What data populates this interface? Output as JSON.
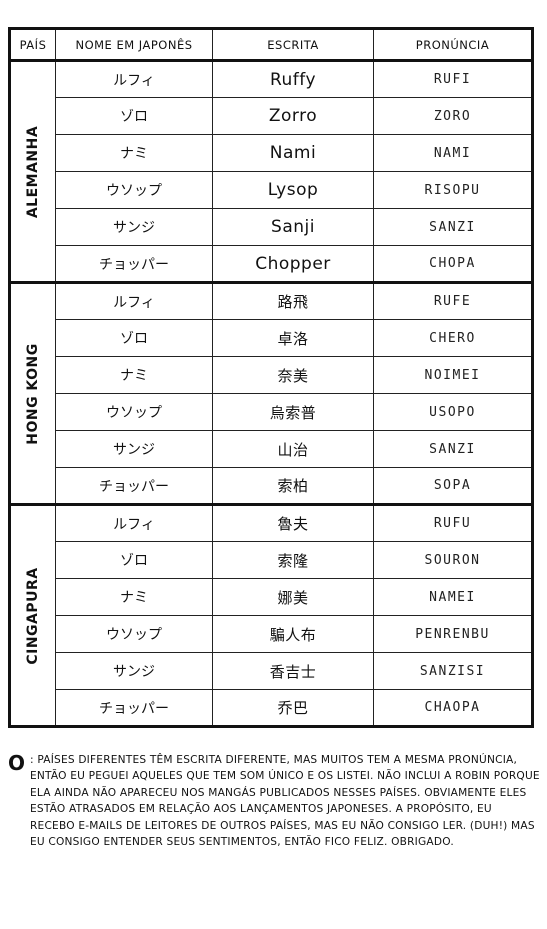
{
  "table": {
    "headers": [
      "PAÍS",
      "NOME EM JAPONÊS",
      "ESCRITA",
      "PRONÚNCIA"
    ],
    "groups": [
      {
        "country": "ALEMANHA",
        "rows": [
          {
            "jp": "ルフィ",
            "written": "Ruffy",
            "pron": "RUFI"
          },
          {
            "jp": "ゾロ",
            "written": "Zorro",
            "pron": "ZORO"
          },
          {
            "jp": "ナミ",
            "written": "Nami",
            "pron": "NAMI"
          },
          {
            "jp": "ウソップ",
            "written": "Lysop",
            "pron": "RISOPU"
          },
          {
            "jp": "サンジ",
            "written": "Sanji",
            "pron": "SANZI"
          },
          {
            "jp": "チョッパー",
            "written": "Chopper",
            "pron": "CHOPA"
          }
        ]
      },
      {
        "country": "HONG KONG",
        "rows": [
          {
            "jp": "ルフィ",
            "written": "路飛",
            "pron": "RUFE"
          },
          {
            "jp": "ゾロ",
            "written": "卓洛",
            "pron": "CHERO"
          },
          {
            "jp": "ナミ",
            "written": "奈美",
            "pron": "NOIMEI"
          },
          {
            "jp": "ウソップ",
            "written": "烏索普",
            "pron": "USOPO"
          },
          {
            "jp": "サンジ",
            "written": "山治",
            "pron": "SANZI"
          },
          {
            "jp": "チョッパー",
            "written": "索柏",
            "pron": "SOPA"
          }
        ]
      },
      {
        "country": "CINGAPURA",
        "rows": [
          {
            "jp": "ルフィ",
            "written": "魯夫",
            "pron": "RUFU"
          },
          {
            "jp": "ゾロ",
            "written": "索隆",
            "pron": "SOURON"
          },
          {
            "jp": "ナミ",
            "written": "娜美",
            "pron": "NAMEI"
          },
          {
            "jp": "ウソップ",
            "written": "騙人布",
            "pron": "PENRENBU"
          },
          {
            "jp": "サンジ",
            "written": "香吉士",
            "pron": "SANZISI"
          },
          {
            "jp": "チョッパー",
            "written": "乔巴",
            "pron": "CHAOPA"
          }
        ]
      }
    ]
  },
  "note": {
    "marker": "O",
    "text": ": PAÍSES DIFERENTES TÊM ESCRITA DIFERENTE, MAS MUITOS TEM A MESMA PRONÚNCIA, ENTÃO EU PEGUEI AQUELES QUE TEM SOM ÚNICO E OS LISTEI. NÃO INCLUI A ROBIN PORQUE ELA AINDA NÃO APARECEU NOS MANGÁS PUBLICADOS NESSES PAÍSES. OBVIAMENTE ELES ESTÃO ATRASADOS EM RELAÇÃO AOS LANÇAMENTOS JAPONESES. A PROPÓSITO, EU RECEBO E-MAILS DE LEITORES DE OUTROS PAÍSES, MAS EU NÃO CONSIGO LER. (DUH!) MAS EU CONSIGO ENTENDER SEUS SENTIMENTOS, ENTÃO FICO FELIZ. OBRIGADO."
  }
}
